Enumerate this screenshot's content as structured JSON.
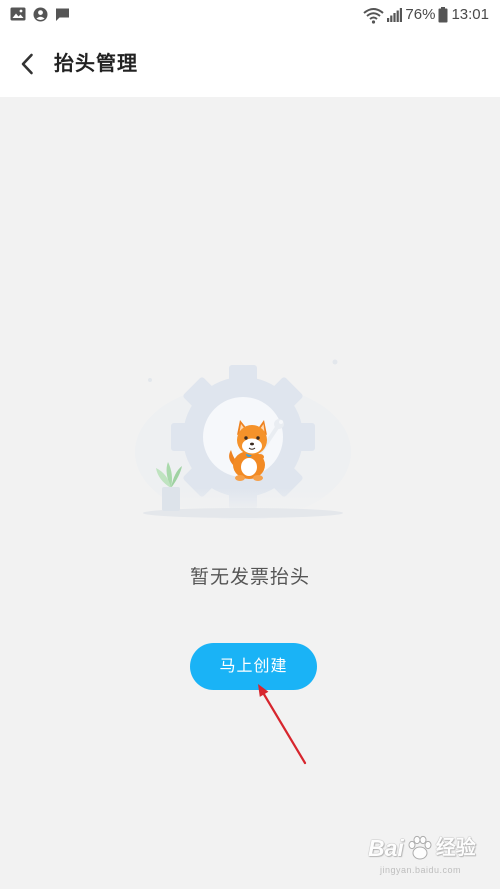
{
  "status_bar": {
    "notification_icons": [
      "image-icon",
      "account-circle-icon",
      "message-icon"
    ],
    "wifi_icon": "wifi-icon",
    "signal_icon": "signal-icon",
    "battery_percent": "76%",
    "battery_icon": "battery-icon",
    "time": "13:01"
  },
  "header": {
    "back_icon": "chevron-left-icon",
    "title": "抬头管理"
  },
  "empty_state": {
    "message": "暂无发票抬头",
    "create_button_label": "马上创建"
  },
  "watermark": {
    "brand": "Bai",
    "brand_icon": "paw-icon",
    "product": "经验",
    "url": "jingyan.baidu.com"
  },
  "colors": {
    "accent": "#1ab3f6",
    "background": "#f2f2f2",
    "header_background": "#ffffff",
    "annotation_arrow": "#d7262e",
    "title_text": "#222222",
    "message_text": "#555555"
  }
}
